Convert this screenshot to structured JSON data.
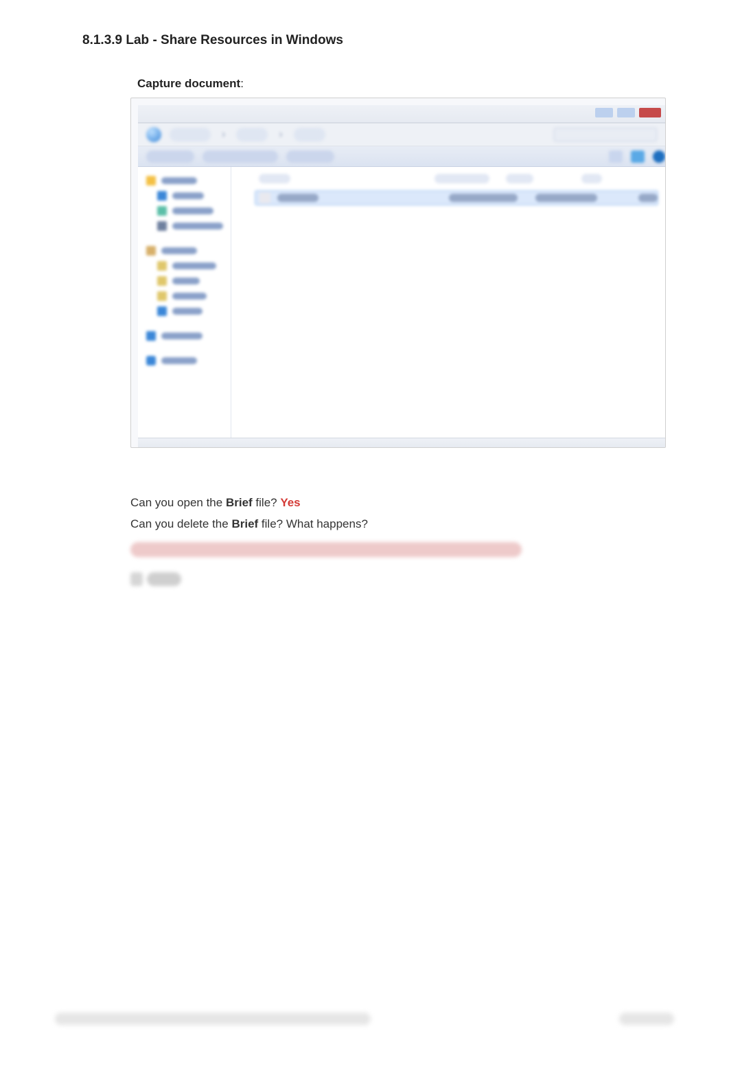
{
  "doc": {
    "title": "8.1.3.9 Lab - Share Resources in Windows",
    "capture_label": "Capture document",
    "capture_colon": ":"
  },
  "explorer": {
    "breadcrumb": [
      "Network",
      "PCx",
      "Users"
    ],
    "search_placeholder": "Search ShareXX",
    "toolbar": [
      "Organize",
      "Include in library",
      "New folder"
    ],
    "nav": [
      {
        "kind": "star",
        "label": "Favorites"
      },
      {
        "kind": "blue",
        "label": "Desktop",
        "sub": true
      },
      {
        "kind": "teal",
        "label": "Downloads",
        "sub": true
      },
      {
        "kind": "dark",
        "label": "Recent Places",
        "sub": true
      },
      {
        "kind": "gap"
      },
      {
        "kind": "lib",
        "label": "Libraries"
      },
      {
        "kind": "folder",
        "label": "Documents",
        "sub": true
      },
      {
        "kind": "folder",
        "label": "Music",
        "sub": true
      },
      {
        "kind": "folder",
        "label": "Pictures",
        "sub": true
      },
      {
        "kind": "blue",
        "label": "Videos",
        "sub": true
      },
      {
        "kind": "gap"
      },
      {
        "kind": "blue",
        "label": "Computer"
      },
      {
        "kind": "gap"
      },
      {
        "kind": "net",
        "label": "Network"
      }
    ],
    "columns": [
      "Name",
      "Date modified",
      "Type",
      "Size"
    ],
    "rows": [
      {
        "label": "Brief",
        "selected": true
      }
    ]
  },
  "qa": {
    "q1_pre": "Can you open the ",
    "q1_b": "Brief",
    "q1_post": " file? ",
    "a1": "Yes",
    "q2_pre": "Can you delete the ",
    "q2_b": "Brief",
    "q2_post": " file? What happens?"
  }
}
